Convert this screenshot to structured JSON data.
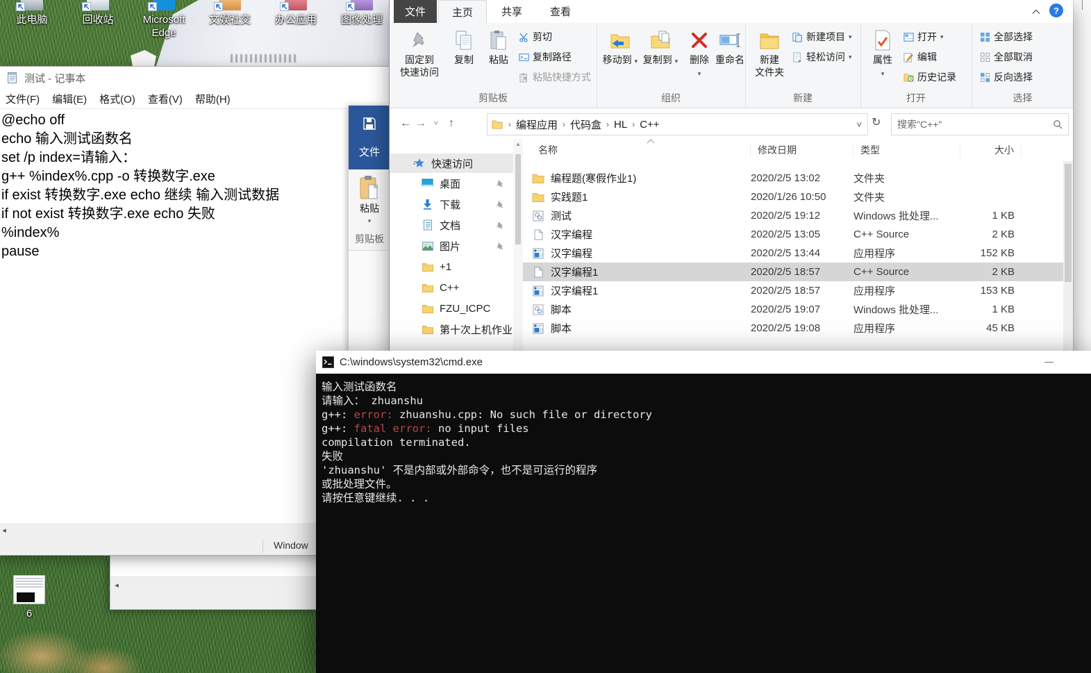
{
  "desktop": {
    "icons": [
      {
        "label": "此电脑",
        "kind": "computer"
      },
      {
        "label": "回收站",
        "kind": "recycle"
      },
      {
        "label": "Microsoft Edge",
        "kind": "edge"
      },
      {
        "label": "文娱社交",
        "kind": "social"
      },
      {
        "label": "办公应用",
        "kind": "office"
      },
      {
        "label": "图像处理",
        "kind": "image"
      }
    ],
    "thumb_label": "6"
  },
  "notepad": {
    "title": "测试 - 记事本",
    "menu": [
      "文件(F)",
      "编辑(E)",
      "格式(O)",
      "查看(V)",
      "帮助(H)"
    ],
    "lines": [
      "@echo off",
      "echo 输入测试函数名",
      "set /p index=请输入：",
      "g++ %index%.cpp -o 转换数字.exe",
      "if exist 转换数字.exe echo 继续 输入测试数据",
      "if not exist 转换数字.exe echo 失败",
      "%index%",
      "pause"
    ],
    "status_text": "Window"
  },
  "word": {
    "file_tab": "文件",
    "paste": "粘贴",
    "clipboard_group": "剪贴板"
  },
  "explorer": {
    "file_tab": "文件",
    "tabs": [
      "主页",
      "共享",
      "查看"
    ],
    "ribbon": {
      "pin_line1": "固定到",
      "pin_line2": "快速访问",
      "copy": "复制",
      "paste": "粘贴",
      "cut": "剪切",
      "copy_path": "复制路径",
      "paste_shortcut": "粘贴快捷方式",
      "clipboard_group": "剪贴板",
      "move_to": "移动到",
      "copy_to": "复制到",
      "delete": "删除",
      "rename": "重命名",
      "organize_group": "组织",
      "new_folder_line1": "新建",
      "new_folder_line2": "文件夹",
      "new_item": "新建项目",
      "easy_access": "轻松访问",
      "new_group": "新建",
      "properties": "属性",
      "open": "打开",
      "edit": "编辑",
      "history": "历史记录",
      "open_group": "打开",
      "select_all": "全部选择",
      "select_none": "全部取消",
      "invert_selection": "反向选择",
      "select_group": "选择"
    },
    "address": {
      "crumbs": [
        "编程应用",
        "代码盒",
        "HL",
        "C++"
      ],
      "search": "搜索\"C++\""
    },
    "sidebar": {
      "header": "快速访问",
      "items": [
        {
          "label": "桌面",
          "kind": "desktop",
          "pinned": true
        },
        {
          "label": "下载",
          "kind": "download",
          "pinned": true
        },
        {
          "label": "文档",
          "kind": "document",
          "pinned": true
        },
        {
          "label": "图片",
          "kind": "picture",
          "pinned": true
        },
        {
          "label": "+1",
          "kind": "folder",
          "pinned": false
        },
        {
          "label": "C++",
          "kind": "folder",
          "pinned": false
        },
        {
          "label": "FZU_ICPC",
          "kind": "folder",
          "pinned": false
        },
        {
          "label": "第十次上机作业",
          "kind": "folder",
          "pinned": false
        }
      ]
    },
    "columns": [
      "名称",
      "修改日期",
      "类型",
      "大小"
    ],
    "rows": [
      {
        "kind": "folder",
        "name": "编程题(寒假作业1)",
        "date": "2020/2/5 13:02",
        "type": "文件夹",
        "size": "",
        "selected": false
      },
      {
        "kind": "folder",
        "name": "实践题1",
        "date": "2020/1/26 10:50",
        "type": "文件夹",
        "size": "",
        "selected": false
      },
      {
        "kind": "bat",
        "name": "测试",
        "date": "2020/2/5 19:12",
        "type": "Windows 批处理...",
        "size": "1 KB",
        "selected": false
      },
      {
        "kind": "src",
        "name": "汉字编程",
        "date": "2020/2/5 13:05",
        "type": "C++ Source",
        "size": "2 KB",
        "selected": false
      },
      {
        "kind": "exe",
        "name": "汉字编程",
        "date": "2020/2/5 13:44",
        "type": "应用程序",
        "size": "152 KB",
        "selected": false
      },
      {
        "kind": "src",
        "name": "汉字编程1",
        "date": "2020/2/5 18:57",
        "type": "C++ Source",
        "size": "2 KB",
        "selected": true
      },
      {
        "kind": "exe",
        "name": "汉字编程1",
        "date": "2020/2/5 18:57",
        "type": "应用程序",
        "size": "153 KB",
        "selected": false
      },
      {
        "kind": "bat",
        "name": "脚本",
        "date": "2020/2/5 19:07",
        "type": "Windows 批处理...",
        "size": "1 KB",
        "selected": false
      },
      {
        "kind": "exe",
        "name": "脚本",
        "date": "2020/2/5 19:08",
        "type": "应用程序",
        "size": "45 KB",
        "selected": false
      }
    ]
  },
  "cmd": {
    "title": "C:\\windows\\system32\\cmd.exe",
    "lines": [
      [
        {
          "t": "输入测试函数名",
          "red": false
        }
      ],
      [
        {
          "t": "请输入： zhuanshu",
          "red": false
        }
      ],
      [
        {
          "t": "g++: ",
          "red": false
        },
        {
          "t": "error:",
          "red": true
        },
        {
          "t": " zhuanshu.cpp: No such file or directory",
          "red": false
        }
      ],
      [
        {
          "t": "g++: ",
          "red": false
        },
        {
          "t": "fatal error:",
          "red": true
        },
        {
          "t": " no input files",
          "red": false
        }
      ],
      [
        {
          "t": "compilation terminated.",
          "red": false
        }
      ],
      [
        {
          "t": "失败",
          "red": false
        }
      ],
      [
        {
          "t": "'zhuanshu' 不是内部或外部命令，也不是可运行的程序",
          "red": false
        }
      ],
      [
        {
          "t": "或批处理文件。",
          "red": false
        }
      ],
      [
        {
          "t": "请按任意键继续. . .",
          "red": false
        }
      ]
    ]
  },
  "colors": {
    "cmd_red": "#b5484f",
    "accent_blue": "#2b7cd3",
    "folder_yellow": "#f7d370",
    "word_blue": "#2b579a",
    "delete_red": "#d23b30"
  }
}
